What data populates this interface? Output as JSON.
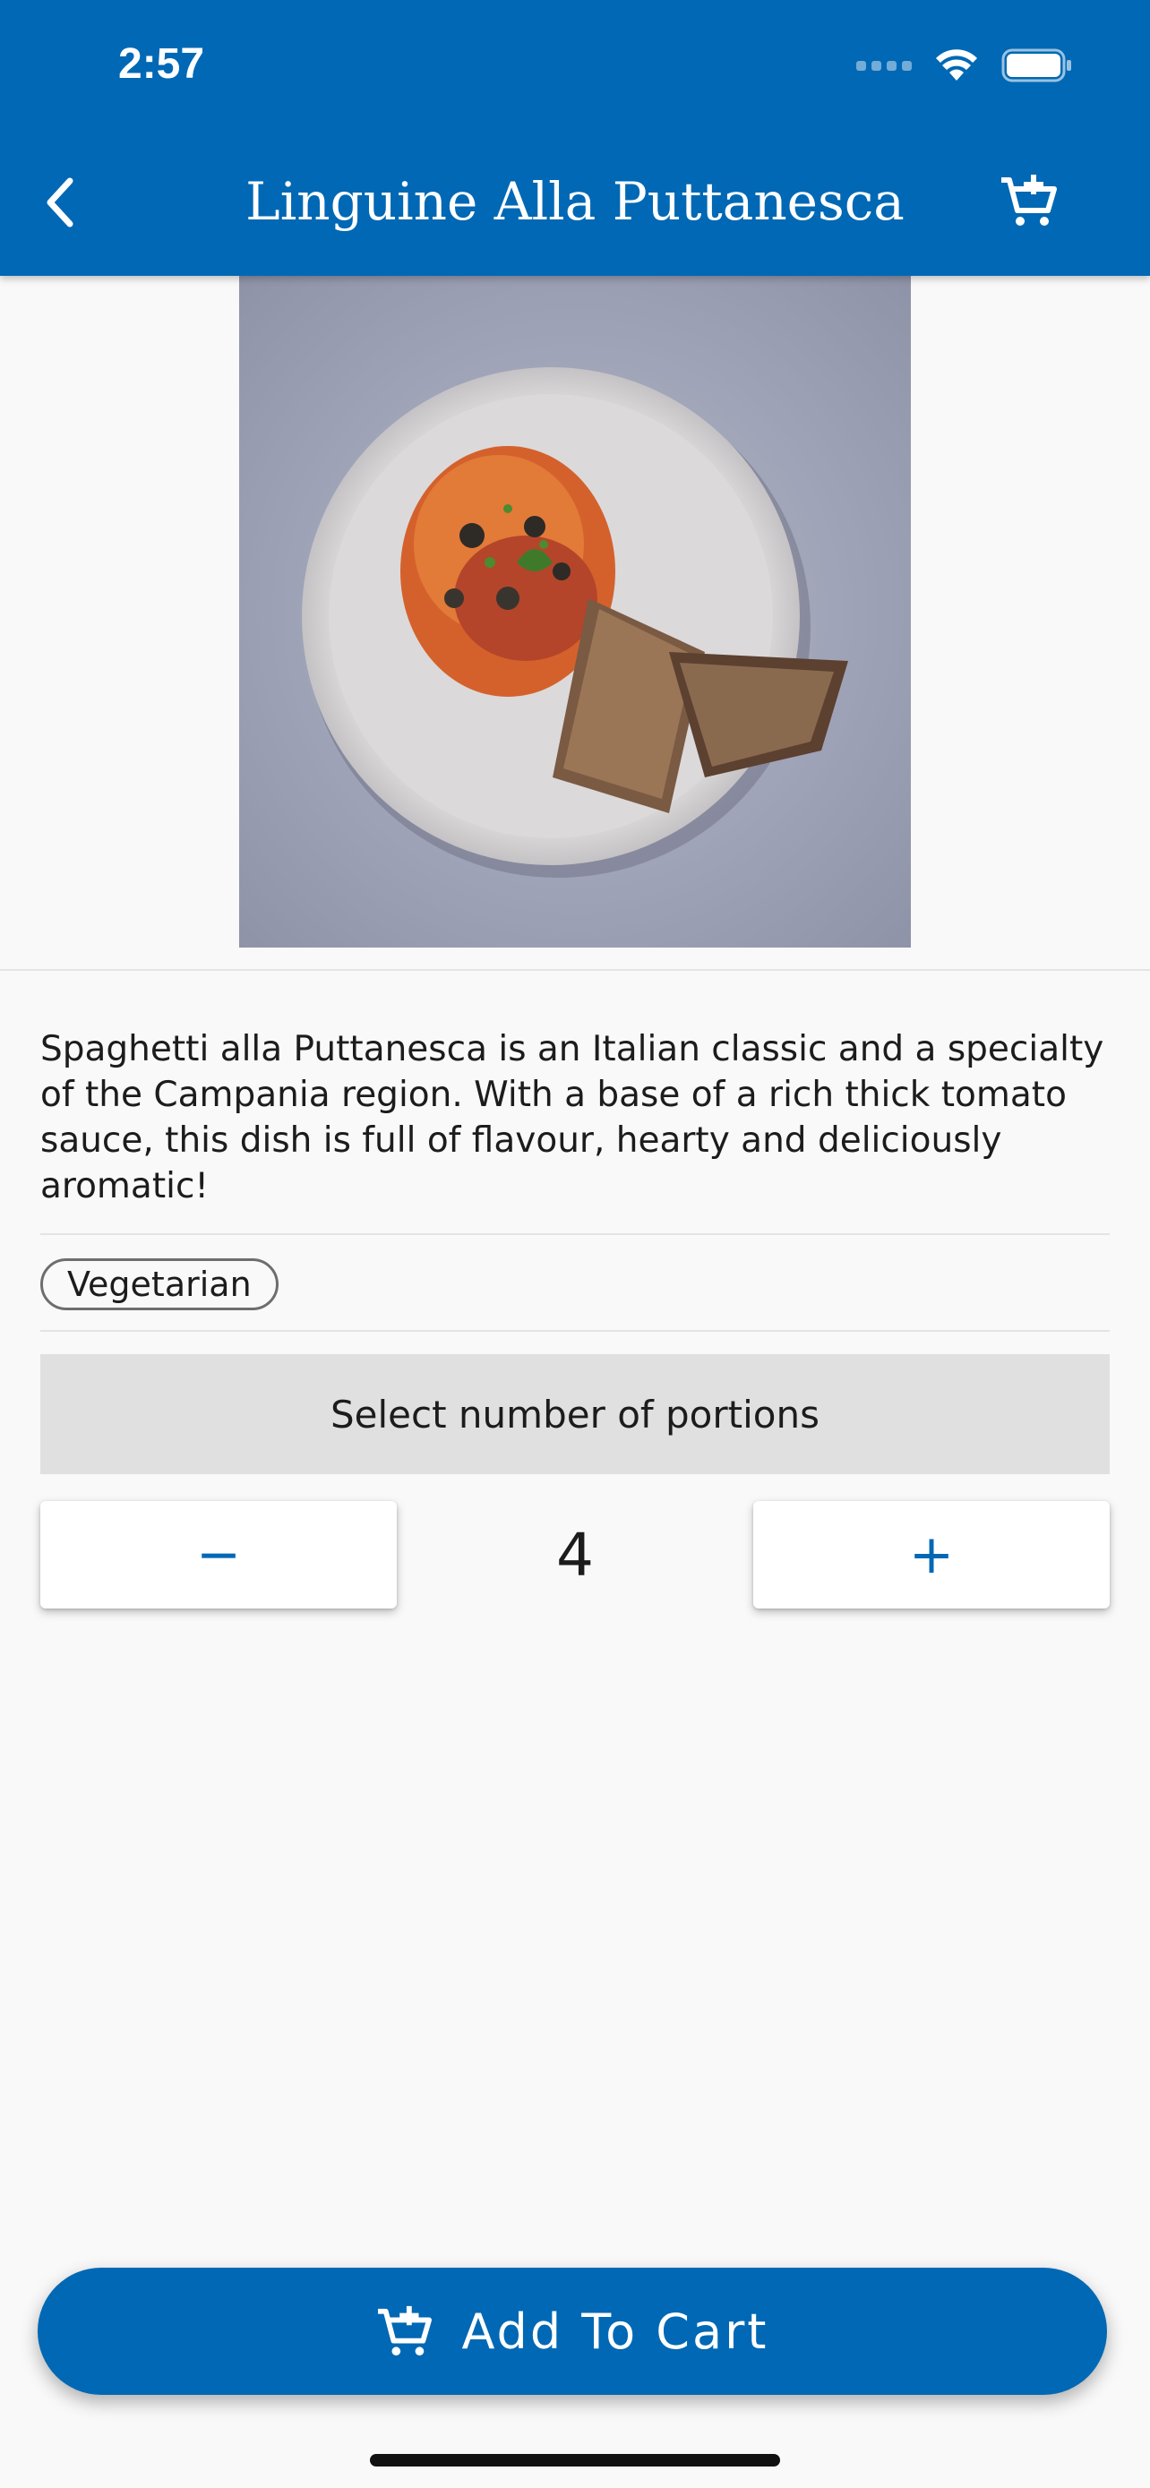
{
  "status_bar": {
    "time": "2:57"
  },
  "header": {
    "title": "Linguine Alla Puttanesca",
    "back_icon": "chevron-left-icon",
    "cart_icon": "cart-add-icon"
  },
  "dish": {
    "image_subject": "plate of pasta with bread",
    "description": "Spaghetti alla Puttanesca is an Italian classic and a specialty of the Campania region. With a base of a rich thick tomato sauce, this dish is full of flavour, hearty and deliciously aromatic!",
    "tags": [
      "Vegetarian"
    ]
  },
  "portions": {
    "label": "Select number of portions",
    "decrement": "−",
    "count": "4",
    "increment": "+"
  },
  "cart_button": {
    "label": "Add To Cart",
    "icon": "cart-add-icon"
  },
  "colors": {
    "primary": "#0068b4",
    "background": "#f9f9f9",
    "panel": "#e0e0e0"
  }
}
